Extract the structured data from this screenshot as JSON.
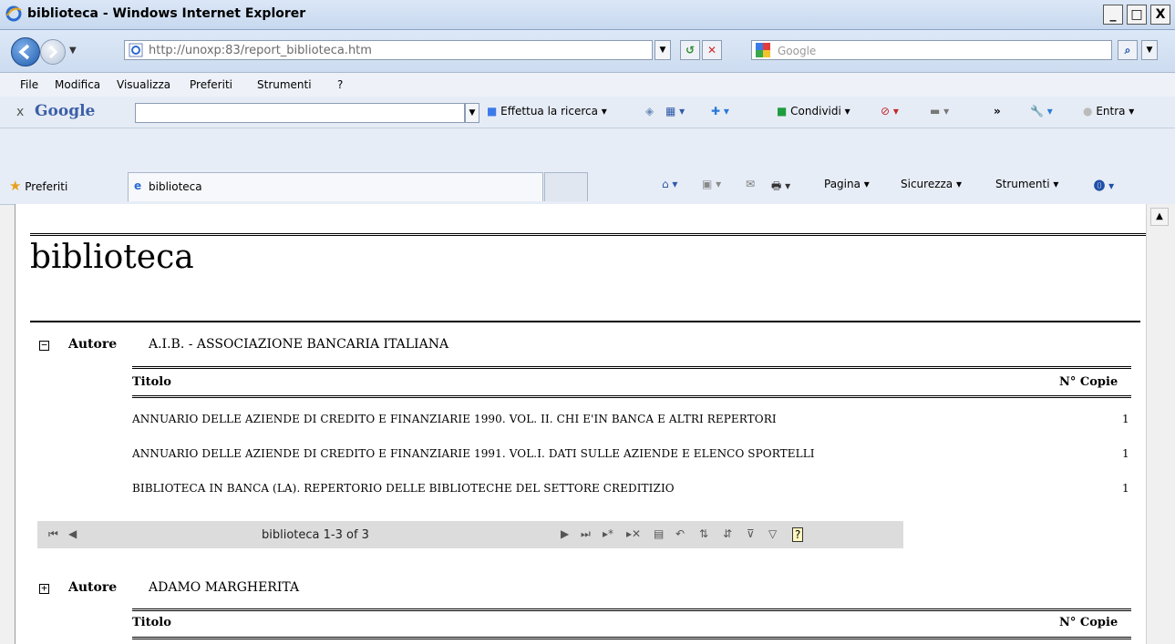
{
  "window": {
    "title": "biblioteca - Windows Internet Explorer",
    "btn_min": "_",
    "btn_max": "□",
    "btn_close": "X"
  },
  "address": {
    "url": "http://unoxp:83/report_biblioteca.htm",
    "search_placeholder": "Google"
  },
  "menu": [
    "File",
    "Modifica",
    "Visualizza",
    "Preferiti",
    "Strumenti",
    "?"
  ],
  "google_toolbar": {
    "x": "x",
    "logo": "Google",
    "search_btn": "Effettua la ricerca ▾",
    "share": "Condividi ▾",
    "more": "»",
    "signin": "Entra ▾"
  },
  "favbar": {
    "favorites": "Preferiti",
    "tab_title": "biblioteca",
    "page": "Pagina ▾",
    "security": "Sicurezza ▾",
    "tools": "Strumenti ▾"
  },
  "report": {
    "title": "biblioteca",
    "groups": [
      {
        "toggle": "−",
        "label": "Autore",
        "value": "A.I.B. - ASSOCIAZIONE BANCARIA ITALIANA",
        "col_title": "Titolo",
        "col_copies": "N° Copie",
        "rows": [
          {
            "title": "ANNUARIO DELLE AZIENDE DI CREDITO E FINANZIARIE 1990. VOL. II. CHI E'IN BANCA E ALTRI REPERTORI",
            "copies": "1"
          },
          {
            "title": "ANNUARIO DELLE AZIENDE DI CREDITO E FINANZIARIE 1991. VOL.I. DATI SULLE AZIENDE E ELENCO SPORTELLI",
            "copies": "1"
          },
          {
            "title": "BIBLIOTECA IN BANCA (LA). REPERTORIO DELLE BIBLIOTECHE DEL SETTORE CREDITIZIO",
            "copies": "1"
          }
        ]
      },
      {
        "toggle": "+",
        "label": "Autore",
        "value": "ADAMO MARGHERITA",
        "col_title": "Titolo",
        "col_copies": "N° Copie"
      }
    ],
    "navigator": {
      "text": "biblioteca 1-3 of 3"
    }
  }
}
